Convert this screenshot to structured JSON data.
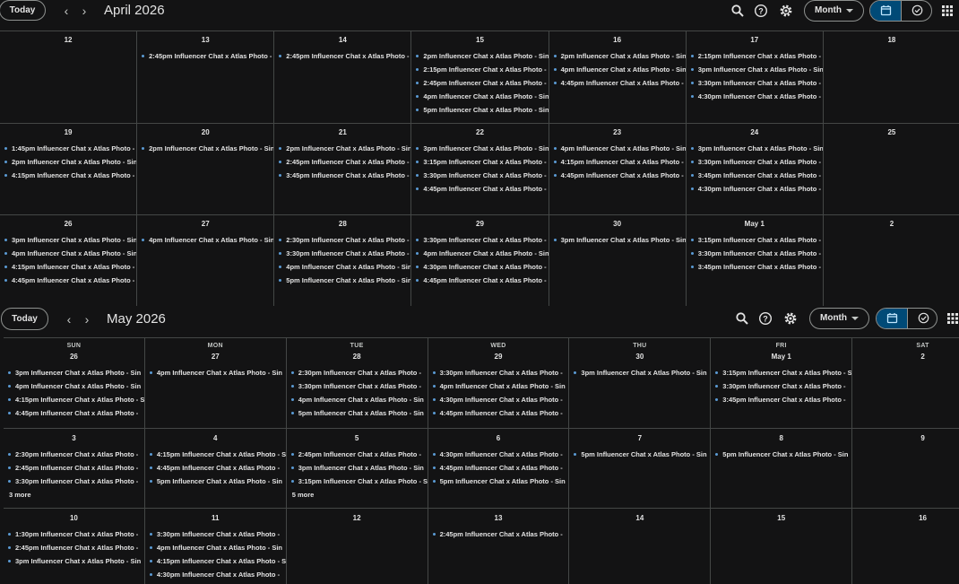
{
  "april": {
    "header": {
      "today": "Today",
      "month": "April 2026",
      "view": "Month"
    },
    "weeks": [
      [
        {
          "date": "12",
          "events": []
        },
        {
          "date": "13",
          "events": [
            "2:45pm Influencer Chat x Atlas Photo -"
          ]
        },
        {
          "date": "14",
          "events": [
            "2:45pm Influencer Chat x Atlas Photo -"
          ]
        },
        {
          "date": "15",
          "events": [
            "2pm Influencer Chat x Atlas Photo - Sin",
            "2:15pm Influencer Chat x Atlas Photo - S",
            "2:45pm Influencer Chat x Atlas Photo -",
            "4pm Influencer Chat x Atlas Photo - Sin",
            "5pm Influencer Chat x Atlas Photo - Sin"
          ]
        },
        {
          "date": "16",
          "events": [
            "2pm Influencer Chat x Atlas Photo - Sin",
            "4pm Influencer Chat x Atlas Photo - Sin",
            "4:45pm Influencer Chat x Atlas Photo -"
          ]
        },
        {
          "date": "17",
          "events": [
            "2:15pm Influencer Chat x Atlas Photo - S",
            "3pm Influencer Chat x Atlas Photo - Sin",
            "3:30pm Influencer Chat x Atlas Photo -",
            "4:30pm Influencer Chat x Atlas Photo -"
          ]
        },
        {
          "date": "18",
          "events": []
        }
      ],
      [
        {
          "date": "19",
          "events": [
            "1:45pm Influencer Chat x Atlas Photo - S",
            "2pm Influencer Chat x Atlas Photo - Sin",
            "4:15pm Influencer Chat x Atlas Photo - S"
          ]
        },
        {
          "date": "20",
          "events": [
            "2pm Influencer Chat x Atlas Photo - Sin"
          ]
        },
        {
          "date": "21",
          "events": [
            "2pm Influencer Chat x Atlas Photo - Sin",
            "2:45pm Influencer Chat x Atlas Photo -",
            "3:45pm Influencer Chat x Atlas Photo -"
          ]
        },
        {
          "date": "22",
          "events": [
            "3pm Influencer Chat x Atlas Photo - Sin",
            "3:15pm Influencer Chat x Atlas Photo - S",
            "3:30pm Influencer Chat x Atlas Photo -",
            "4:45pm Influencer Chat x Atlas Photo -"
          ]
        },
        {
          "date": "23",
          "events": [
            "4pm Influencer Chat x Atlas Photo - Sin",
            "4:15pm Influencer Chat x Atlas Photo - S",
            "4:45pm Influencer Chat x Atlas Photo -"
          ]
        },
        {
          "date": "24",
          "events": [
            "3pm Influencer Chat x Atlas Photo - Sin",
            "3:30pm Influencer Chat x Atlas Photo -",
            "3:45pm Influencer Chat x Atlas Photo -",
            "4:30pm Influencer Chat x Atlas Photo -"
          ]
        },
        {
          "date": "25",
          "events": []
        }
      ],
      [
        {
          "date": "26",
          "events": [
            "3pm Influencer Chat x Atlas Photo - Sin",
            "4pm Influencer Chat x Atlas Photo - Sin",
            "4:15pm Influencer Chat x Atlas Photo - S",
            "4:45pm Influencer Chat x Atlas Photo -"
          ]
        },
        {
          "date": "27",
          "events": [
            "4pm Influencer Chat x Atlas Photo - Sin"
          ]
        },
        {
          "date": "28",
          "events": [
            "2:30pm Influencer Chat x Atlas Photo -",
            "3:30pm Influencer Chat x Atlas Photo -",
            "4pm Influencer Chat x Atlas Photo - Sin",
            "5pm Influencer Chat x Atlas Photo - Sin"
          ]
        },
        {
          "date": "29",
          "events": [
            "3:30pm Influencer Chat x Atlas Photo -",
            "4pm Influencer Chat x Atlas Photo - Sin",
            "4:30pm Influencer Chat x Atlas Photo -",
            "4:45pm Influencer Chat x Atlas Photo -"
          ]
        },
        {
          "date": "30",
          "events": [
            "3pm Influencer Chat x Atlas Photo - Sin"
          ]
        },
        {
          "date": "May 1",
          "events": [
            "3:15pm Influencer Chat x Atlas Photo - S",
            "3:30pm Influencer Chat x Atlas Photo -",
            "3:45pm Influencer Chat x Atlas Photo -"
          ]
        },
        {
          "date": "2",
          "events": []
        }
      ]
    ]
  },
  "may": {
    "header": {
      "today": "Today",
      "month": "May 2026",
      "view": "Month"
    },
    "weekdays": [
      "SUN",
      "MON",
      "TUE",
      "WED",
      "THU",
      "FRI",
      "SAT"
    ],
    "weeks": [
      [
        {
          "date": "26",
          "events": [
            "3pm Influencer Chat x Atlas Photo - Sin",
            "4pm Influencer Chat x Atlas Photo - Sin",
            "4:15pm Influencer Chat x Atlas Photo - S",
            "4:45pm Influencer Chat x Atlas Photo -"
          ]
        },
        {
          "date": "27",
          "events": [
            "4pm Influencer Chat x Atlas Photo - Sin"
          ]
        },
        {
          "date": "28",
          "events": [
            "2:30pm Influencer Chat x Atlas Photo -",
            "3:30pm Influencer Chat x Atlas Photo -",
            "4pm Influencer Chat x Atlas Photo - Sin",
            "5pm Influencer Chat x Atlas Photo - Sin"
          ]
        },
        {
          "date": "29",
          "events": [
            "3:30pm Influencer Chat x Atlas Photo -",
            "4pm Influencer Chat x Atlas Photo - Sin",
            "4:30pm Influencer Chat x Atlas Photo -",
            "4:45pm Influencer Chat x Atlas Photo -"
          ]
        },
        {
          "date": "30",
          "events": [
            "3pm Influencer Chat x Atlas Photo - Sin"
          ]
        },
        {
          "date": "May 1",
          "events": [
            "3:15pm Influencer Chat x Atlas Photo - S",
            "3:30pm Influencer Chat x Atlas Photo -",
            "3:45pm Influencer Chat x Atlas Photo -"
          ]
        },
        {
          "date": "2",
          "events": []
        }
      ],
      [
        {
          "date": "3",
          "events": [
            "2:30pm Influencer Chat x Atlas Photo -",
            "2:45pm Influencer Chat x Atlas Photo -",
            "3:30pm Influencer Chat x Atlas Photo -"
          ],
          "more": "3 more"
        },
        {
          "date": "4",
          "events": [
            "4:15pm Influencer Chat x Atlas Photo - S",
            "4:45pm Influencer Chat x Atlas Photo -",
            "5pm Influencer Chat x Atlas Photo - Sin"
          ]
        },
        {
          "date": "5",
          "events": [
            "2:45pm Influencer Chat x Atlas Photo -",
            "3pm Influencer Chat x Atlas Photo - Sin",
            "3:15pm Influencer Chat x Atlas Photo - S"
          ],
          "more": "5 more"
        },
        {
          "date": "6",
          "events": [
            "4:30pm Influencer Chat x Atlas Photo -",
            "4:45pm Influencer Chat x Atlas Photo -",
            "5pm Influencer Chat x Atlas Photo - Sin"
          ]
        },
        {
          "date": "7",
          "events": [
            "5pm Influencer Chat x Atlas Photo - Sin"
          ]
        },
        {
          "date": "8",
          "events": [
            "5pm Influencer Chat x Atlas Photo - Sin"
          ]
        },
        {
          "date": "9",
          "events": []
        }
      ],
      [
        {
          "date": "10",
          "events": [
            "1:30pm Influencer Chat x Atlas Photo -",
            "2:45pm Influencer Chat x Atlas Photo -",
            "3pm Influencer Chat x Atlas Photo - Sin"
          ]
        },
        {
          "date": "11",
          "events": [
            "3:30pm Influencer Chat x Atlas Photo -",
            "4pm Influencer Chat x Atlas Photo - Sin",
            "4:15pm Influencer Chat x Atlas Photo - S",
            "4:30pm Influencer Chat x Atlas Photo -"
          ]
        },
        {
          "date": "12",
          "events": []
        },
        {
          "date": "13",
          "events": [
            "2:45pm Influencer Chat x Atlas Photo -"
          ]
        },
        {
          "date": "14",
          "events": []
        },
        {
          "date": "15",
          "events": []
        },
        {
          "date": "16",
          "events": []
        }
      ]
    ]
  },
  "colors": {
    "background": "#131314",
    "gridline": "#444746",
    "event_dot": "#5b9bd5",
    "selected_view": "#004a77"
  },
  "icons": [
    "chevron-left-icon",
    "chevron-right-icon",
    "search-icon",
    "help-icon",
    "gear-icon",
    "calendar-icon",
    "tasks-check-icon",
    "apps-grid-icon"
  ]
}
